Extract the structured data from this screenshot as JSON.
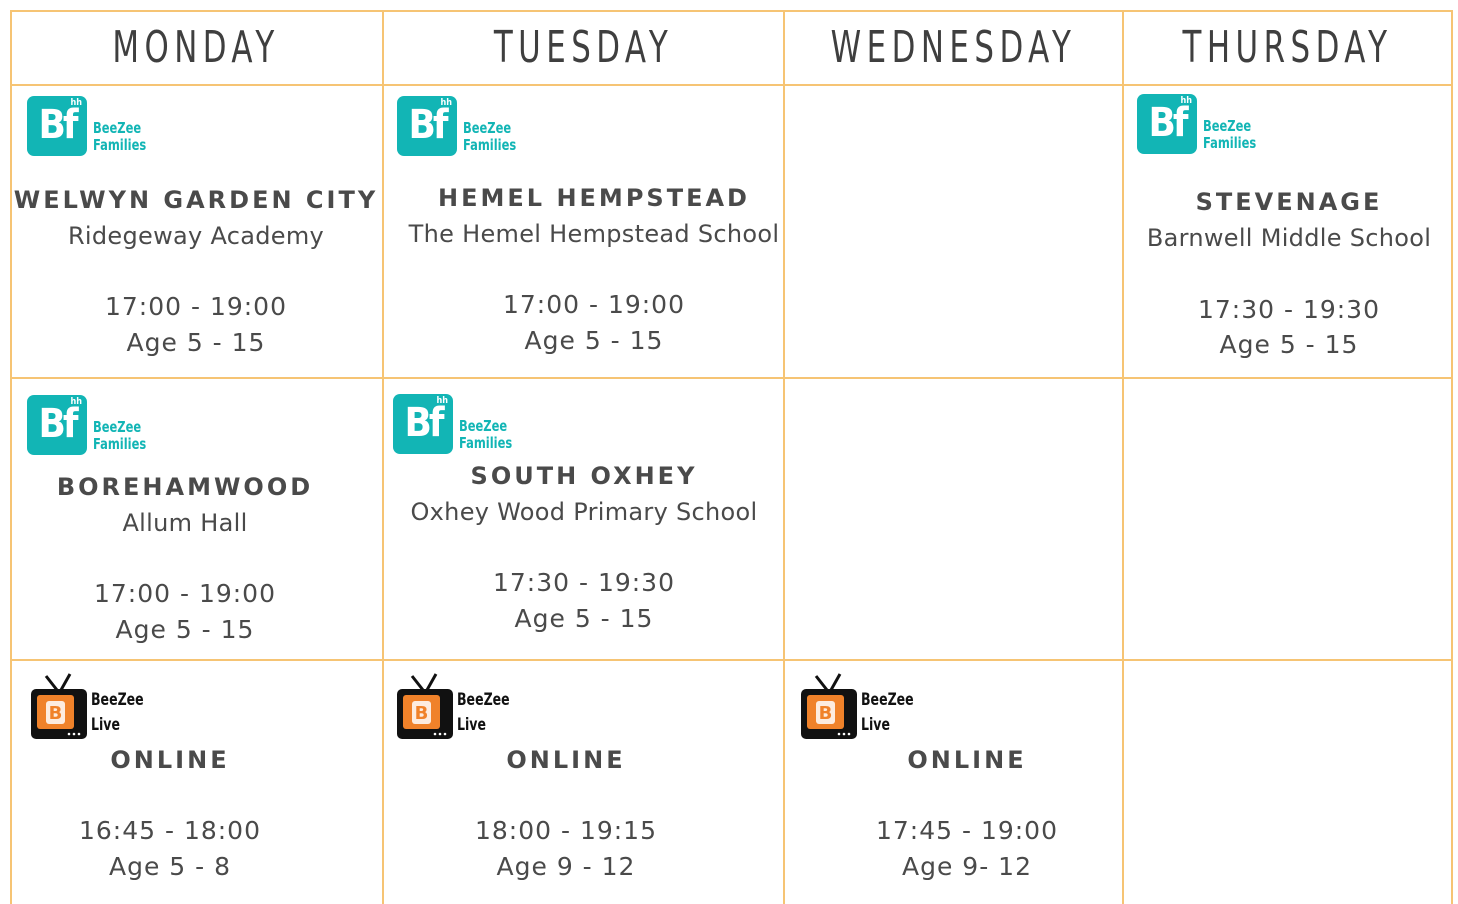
{
  "days": [
    "MONDAY",
    "TUESDAY",
    "WEDNESDAY",
    "THURSDAY"
  ],
  "brand": {
    "families_line1": "BeeZee",
    "families_line2": "Families",
    "families_mark": "Bf",
    "families_mark_small": "hh",
    "live_line1": "BeeZee",
    "live_line2": "Live",
    "families_color": "#12b5b5",
    "live_color": "#f0822a",
    "grid_color": "#f6c474"
  },
  "sessions": {
    "mon1": {
      "location": "WELWYN GARDEN CITY",
      "venue": "Ridegeway Academy",
      "time": "17:00 - 19:00",
      "age": "Age 5 - 15"
    },
    "tue1": {
      "location": "HEMEL HEMPSTEAD",
      "venue": "The Hemel Hempstead School",
      "time": "17:00 - 19:00",
      "age": "Age 5 - 15"
    },
    "thu1": {
      "location": "STEVENAGE",
      "venue": "Barnwell Middle School",
      "time": "17:30 - 19:30",
      "age": "Age 5 - 15"
    },
    "mon2": {
      "location": "BOREHAMWOOD",
      "venue": "Allum Hall",
      "time": "17:00 - 19:00",
      "age": "Age 5 - 15"
    },
    "tue2": {
      "location": "SOUTH OXHEY",
      "venue": "Oxhey Wood Primary School",
      "time": "17:30 - 19:30",
      "age": "Age 5 - 15"
    },
    "mon3": {
      "location": "ONLINE",
      "time": "16:45 - 18:00",
      "age": "Age 5 - 8"
    },
    "tue3": {
      "location": "ONLINE",
      "time": "18:00 - 19:15",
      "age": "Age 9 - 12"
    },
    "wed3": {
      "location": "ONLINE",
      "time": "17:45 - 19:00",
      "age": "Age 9- 12"
    }
  }
}
